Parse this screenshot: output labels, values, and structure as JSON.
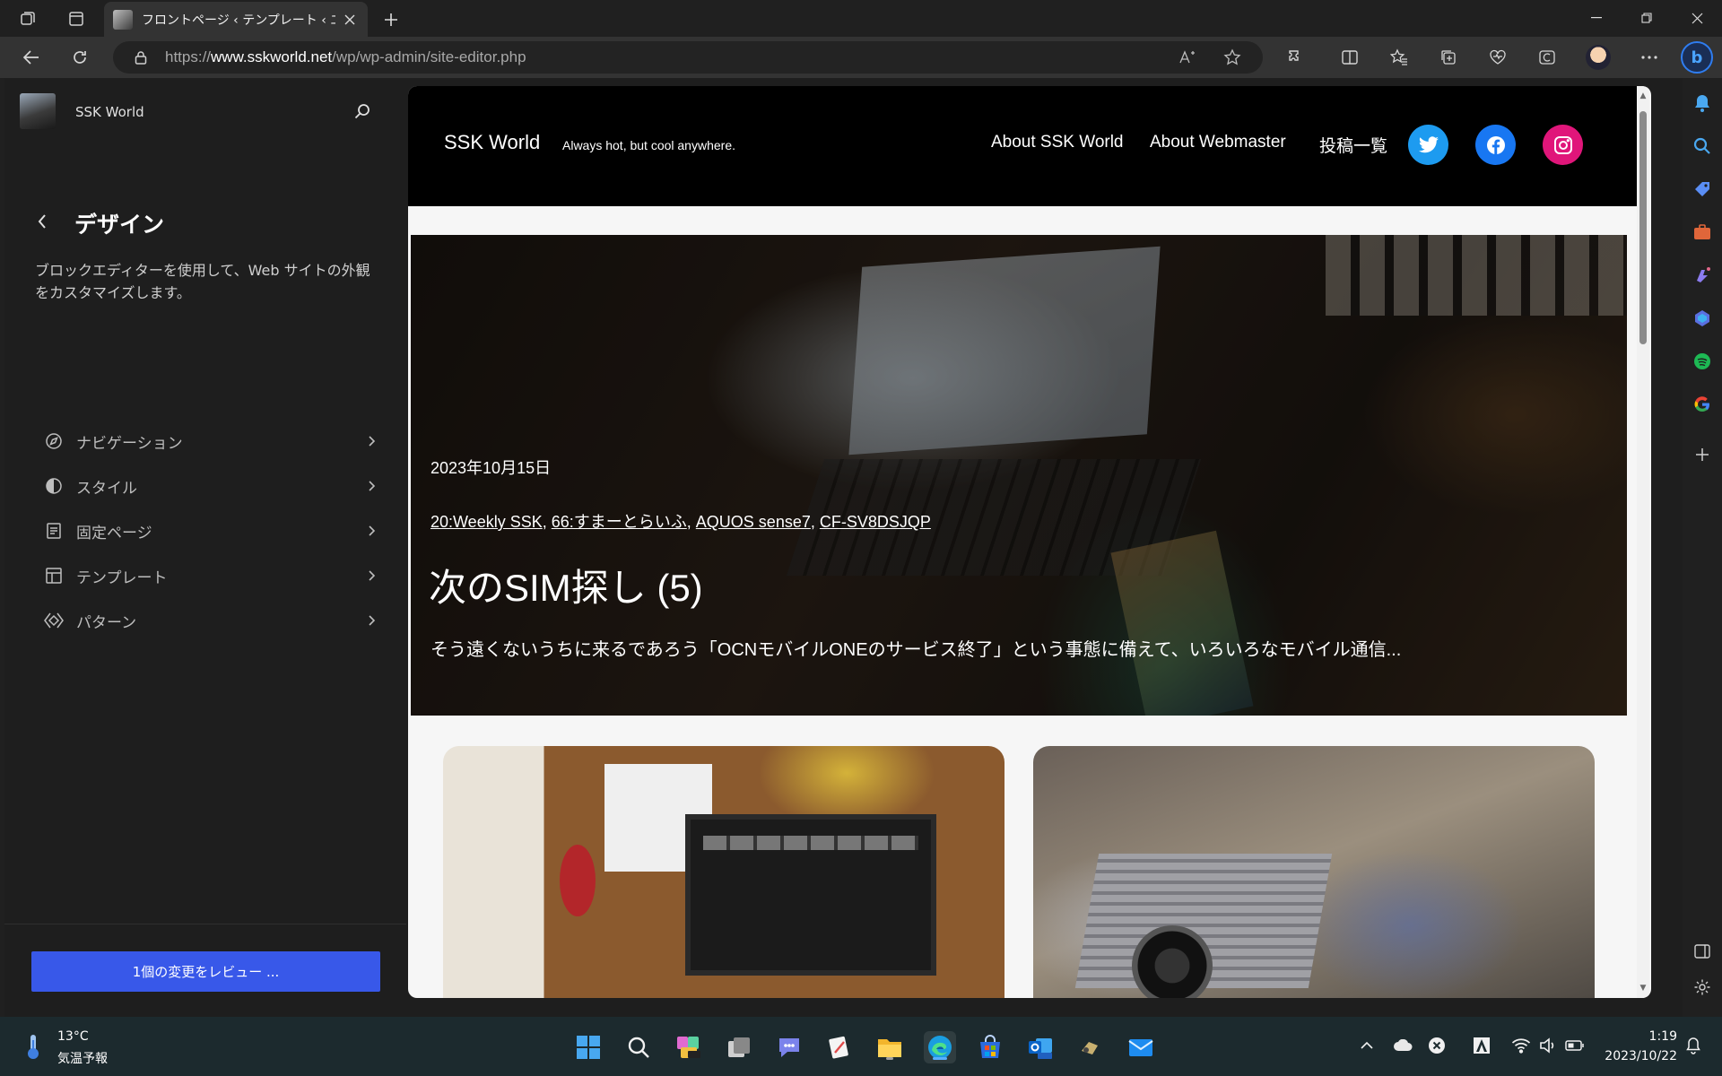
{
  "browser": {
    "tab_title": "フロントページ ‹ テンプレート ‹ エディター",
    "url_prefix": "https://",
    "url_host": "www.sskworld.net",
    "url_path": "/wp/wp-admin/site-editor.php"
  },
  "wp_sidebar": {
    "site_title": "SSK World",
    "section_title": "デザイン",
    "section_desc": "ブロックエディターを使用して、Web サイトの外観をカスタマイズします。",
    "menu": [
      {
        "label": "ナビゲーション",
        "icon": "navigation-icon"
      },
      {
        "label": "スタイル",
        "icon": "styles-icon"
      },
      {
        "label": "固定ページ",
        "icon": "page-icon"
      },
      {
        "label": "テンプレート",
        "icon": "layout-icon"
      },
      {
        "label": "パターン",
        "icon": "symbol-icon"
      }
    ],
    "review_label": "1個の変更をレビュー ..."
  },
  "site_header": {
    "title": "SSK World",
    "tagline": "Always hot, but cool anywhere.",
    "nav": [
      "About SSK World",
      "About Webmaster",
      "投稿一覧"
    ]
  },
  "hero": {
    "date": "2023年10月15日",
    "tags": [
      "20:Weekly SSK",
      "66:すまーとらいふ",
      "AQUOS sense7",
      "CF-SV8DSJQP"
    ],
    "title": "次のSIM探し (5)",
    "excerpt": "そう遠くないうちに来るであろう「OCNモバイルONEのサービス終了」という事態に備えて、いろいろなモバイル通信..."
  },
  "taskbar": {
    "temp": "13°C",
    "weather": "気温予報",
    "time": "1:19",
    "date": "2023/10/22"
  },
  "colors": {
    "accent": "#3858e9",
    "twitter": "#1d9bf0",
    "facebook": "#1877f2",
    "instagram": "#e0167a"
  }
}
